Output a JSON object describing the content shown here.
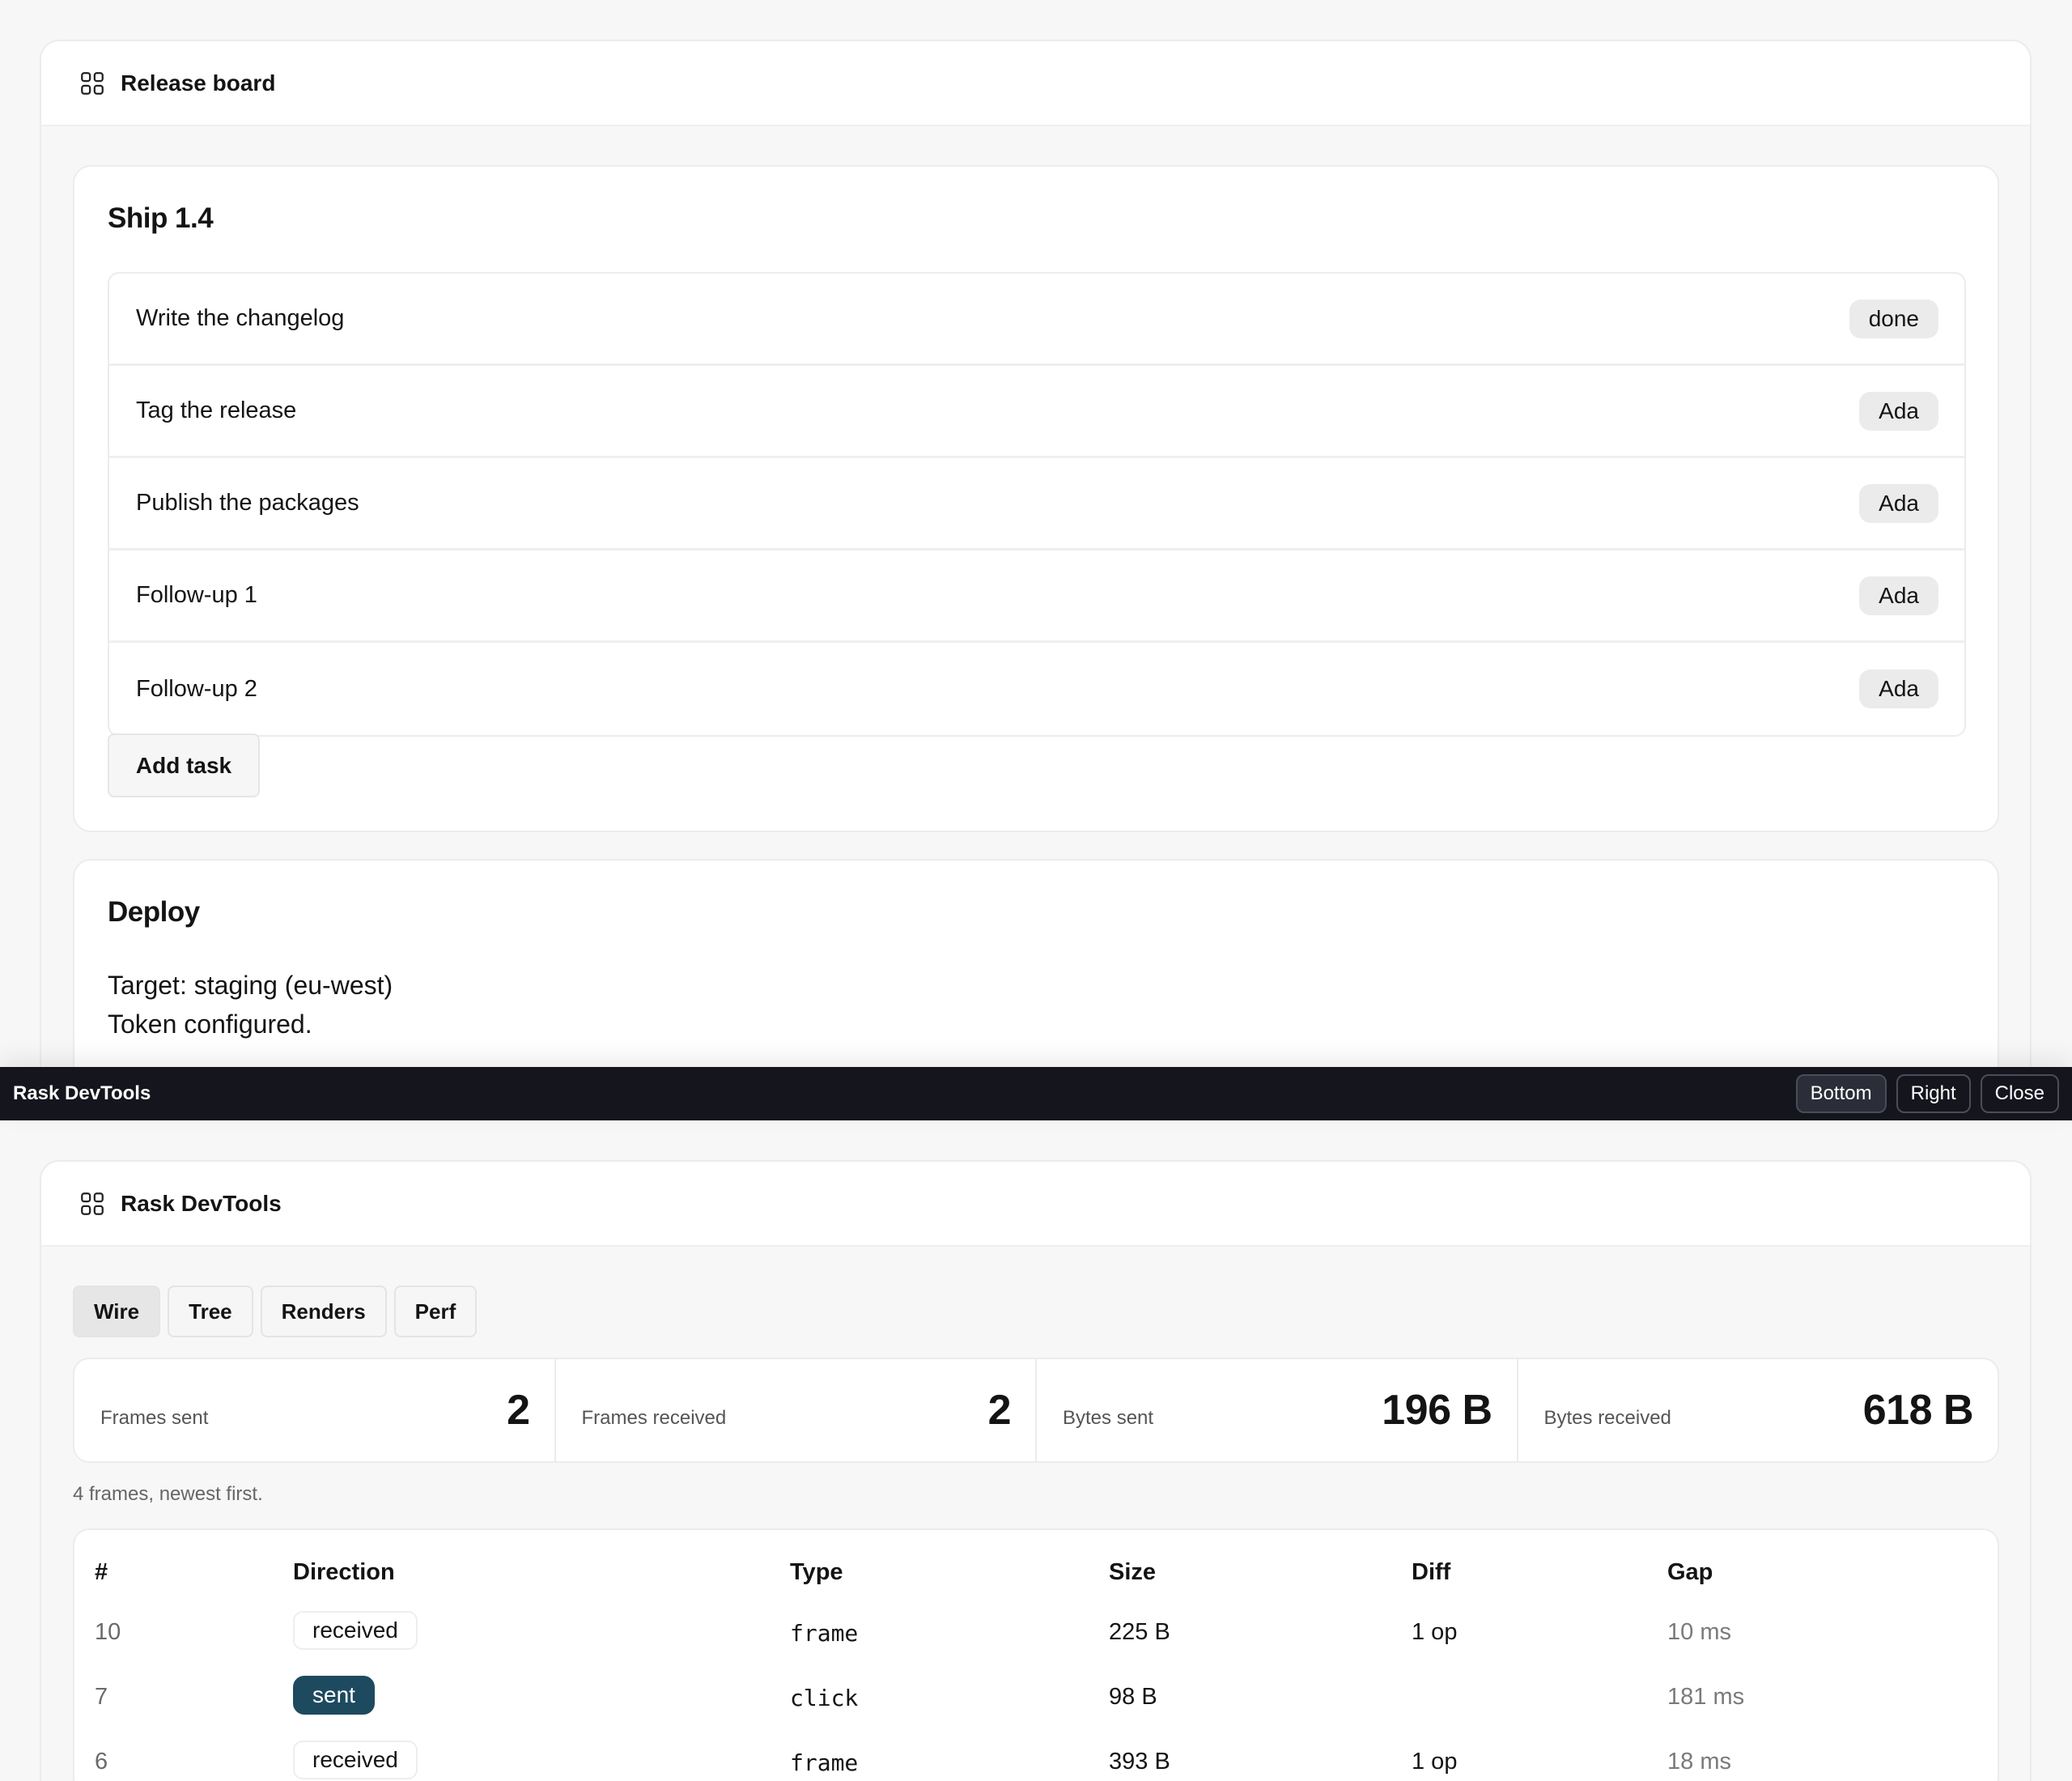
{
  "app": {
    "title": "Release board"
  },
  "ship": {
    "heading": "Ship 1.4",
    "tasks": [
      {
        "label": "Write the changelog",
        "badge": "done"
      },
      {
        "label": "Tag the release",
        "badge": "Ada"
      },
      {
        "label": "Publish the packages",
        "badge": "Ada"
      },
      {
        "label": "Follow-up 1",
        "badge": "Ada"
      },
      {
        "label": "Follow-up 2",
        "badge": "Ada"
      }
    ],
    "add_label": "Add task"
  },
  "deploy": {
    "heading": "Deploy",
    "target": "Target: staging (eu-west)",
    "token": "Token configured."
  },
  "devbar": {
    "title": "Rask DevTools",
    "buttons": [
      "Bottom",
      "Right",
      "Close"
    ],
    "active_button": "Bottom"
  },
  "devtools": {
    "title": "Rask DevTools",
    "tabs": [
      "Wire",
      "Tree",
      "Renders",
      "Perf"
    ],
    "active_tab": "Wire",
    "stats": [
      {
        "label": "Frames sent",
        "value": "2"
      },
      {
        "label": "Frames received",
        "value": "2"
      },
      {
        "label": "Bytes sent",
        "value": "196 B"
      },
      {
        "label": "Bytes received",
        "value": "618 B"
      }
    ],
    "frames_note": "4 frames, newest first.",
    "table": {
      "headers": [
        "#",
        "Direction",
        "Type",
        "Size",
        "Diff",
        "Gap"
      ],
      "rows": [
        {
          "num": "10",
          "direction": "received",
          "type": "frame",
          "size": "225 B",
          "diff": "1 op",
          "gap": "10 ms"
        },
        {
          "num": "7",
          "direction": "sent",
          "type": "click",
          "size": "98 B",
          "diff": "",
          "gap": "181 ms"
        },
        {
          "num": "6",
          "direction": "received",
          "type": "frame",
          "size": "393 B",
          "diff": "1 op",
          "gap": "18 ms"
        }
      ]
    }
  },
  "colors": {
    "background": "#f7f7f7",
    "devbar": "#15161d",
    "sent_pill": "#1e4a60"
  },
  "icons": {
    "app": "grid-icon"
  }
}
